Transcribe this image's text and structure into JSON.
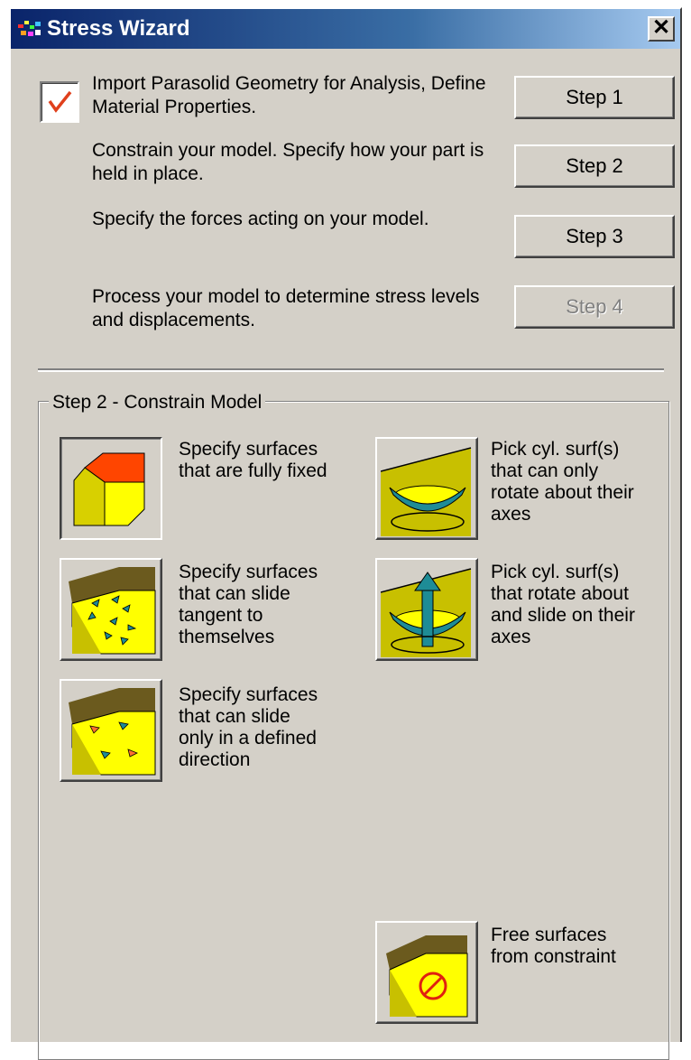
{
  "window": {
    "title": "Stress Wizard",
    "close_label": "✕"
  },
  "steps": [
    {
      "description": "Import Parasolid Geometry for Analysis, Define Material Properties.",
      "button_label": "Step 1",
      "enabled": true,
      "completed": true
    },
    {
      "description": "Constrain your model. Specify how your part is held in place.",
      "button_label": "Step 2",
      "enabled": true,
      "completed": false
    },
    {
      "description": "Specify the forces acting on your model.",
      "button_label": "Step 3",
      "enabled": true,
      "completed": false
    },
    {
      "description": "Process your model to determine stress levels and displacements.",
      "button_label": "Step 4",
      "enabled": false,
      "completed": false
    }
  ],
  "group": {
    "title": "Step 2 - Constrain Model",
    "options": [
      {
        "icon": "fixed-surface-icon",
        "label": "Specify surfaces\nthat are fully fixed",
        "selected": true
      },
      {
        "icon": "slide-tangent-icon",
        "label": "Specify surfaces\nthat can slide\ntangent to\nthemselves",
        "selected": false
      },
      {
        "icon": "slide-direction-icon",
        "label": "Specify surfaces\nthat can slide\nonly in a defined\ndirection",
        "selected": false
      },
      {
        "icon": "cylinder-rotate-icon",
        "label": "Pick cyl. surf(s)\nthat can only\nrotate about their\naxes",
        "selected": false
      },
      {
        "icon": "cylinder-rotate-slide-icon",
        "label": "Pick cyl. surf(s)\nthat rotate about\nand slide on their\naxes",
        "selected": false
      },
      {
        "icon": "free-surface-icon",
        "label": "Free surfaces\nfrom constraint",
        "selected": false
      }
    ]
  },
  "colors": {
    "title_bar_start": "#0a246a",
    "title_bar_end": "#a6caf0",
    "dialog_face": "#d4d0c8",
    "icon_yellow": "#ffff00",
    "icon_fixed_face": "#ff4500",
    "icon_teal": "#1e8c96",
    "check_mark": "#e0401c"
  }
}
